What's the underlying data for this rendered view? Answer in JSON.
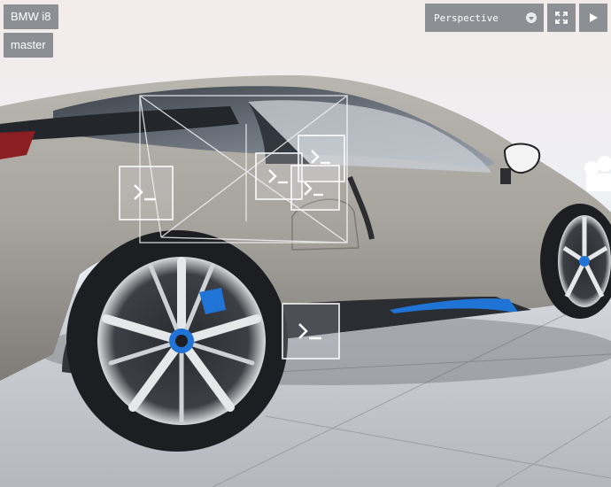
{
  "scene": {
    "name": "BMW i8",
    "branch": "master"
  },
  "toolbar": {
    "camera_mode": "Perspective",
    "camera_dropdown_icon": "chevron-down-icon",
    "fullscreen_icon": "fullscreen-icon",
    "play_icon": "play-icon"
  },
  "helpers": [
    {
      "name": "script-helper-left",
      "icon": "terminal-icon"
    },
    {
      "name": "script-helper-door-1",
      "icon": "terminal-icon"
    },
    {
      "name": "script-helper-door-2",
      "icon": "terminal-icon"
    },
    {
      "name": "script-helper-window",
      "icon": "terminal-icon"
    },
    {
      "name": "script-helper-sill",
      "icon": "terminal-icon"
    }
  ],
  "colors": {
    "toolbar_bg": "#8c8f93",
    "car_body": "#a39f9a",
    "accent_blue": "#1f74d6"
  }
}
